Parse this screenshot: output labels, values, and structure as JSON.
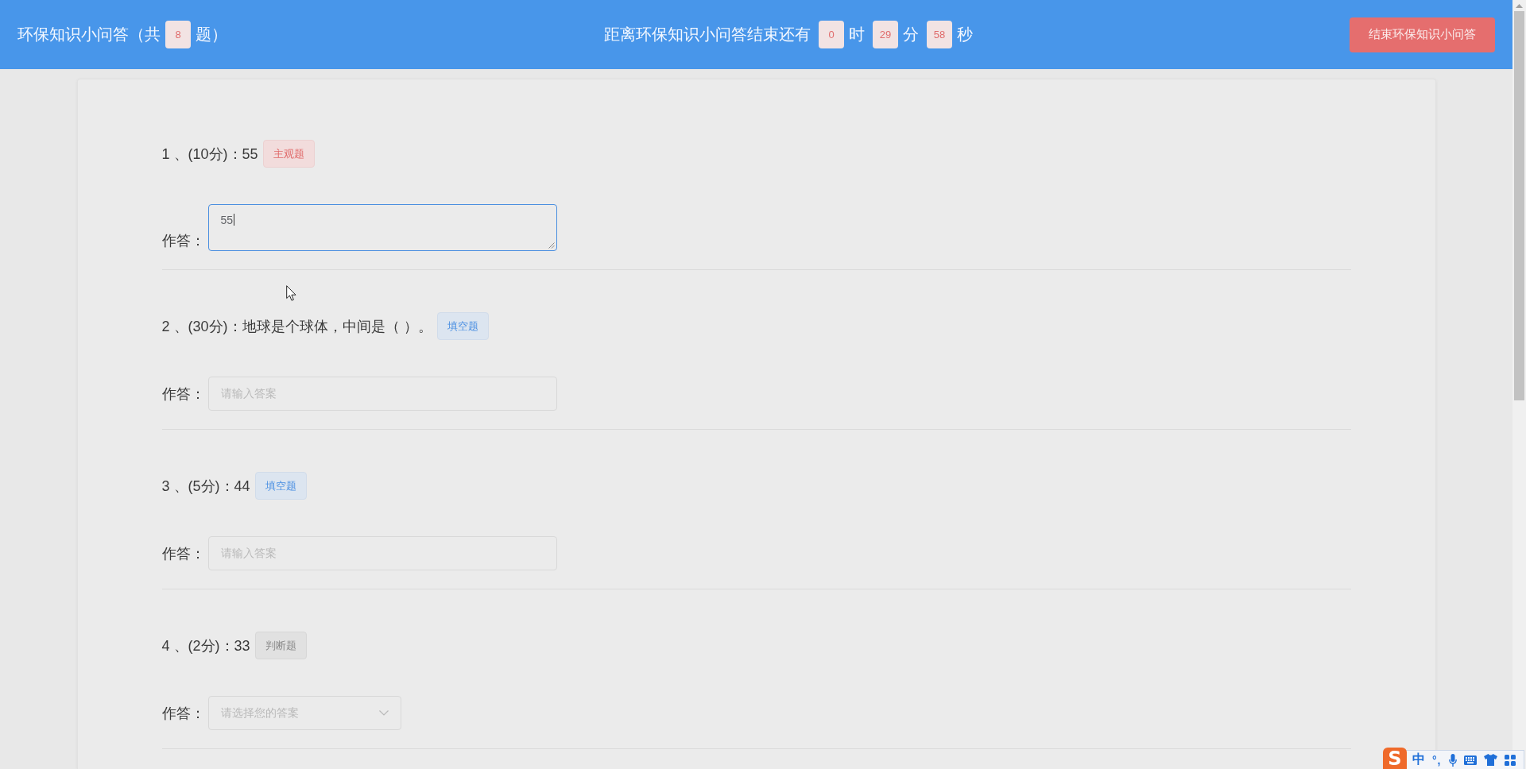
{
  "header": {
    "title": "环保知识小问答",
    "count_prefix": "（共",
    "question_count": "8",
    "count_suffix": "题）",
    "countdown": {
      "label": "距离环保知识小问答结束还有",
      "parts": [
        {
          "value": "0",
          "unit": "时"
        },
        {
          "value": "29",
          "unit": "分"
        },
        {
          "value": "58",
          "unit": "秒"
        }
      ]
    },
    "end_button": "结束环保知识小问答"
  },
  "questions": [
    {
      "title": "1 、(10分)：55",
      "tag": "主观题",
      "kind": "subjective",
      "answer": {
        "label": "作答：",
        "kind": "textarea",
        "value": "55",
        "focused": true
      }
    },
    {
      "title": "2 、(30分)：地球是个球体，中间是（ ）。",
      "tag": "填空题",
      "kind": "fill_blank",
      "answer": {
        "label": "作答：",
        "kind": "input",
        "placeholder": "请输入答案",
        "focused": false
      }
    },
    {
      "title": "3 、(5分)：44",
      "tag": "填空题",
      "kind": "fill_blank",
      "answer": {
        "label": "作答：",
        "kind": "input",
        "placeholder": "请输入答案",
        "focused": false
      }
    },
    {
      "title": "4 、(2分)：33",
      "tag": "判断题",
      "kind": "true_false",
      "answer": {
        "label": "作答：",
        "kind": "select",
        "placeholder": "请选择您的答案",
        "focused": false
      }
    }
  ],
  "ime_toolbar": {
    "logo": "S",
    "mode": "中",
    "punctuation": "°,"
  }
}
